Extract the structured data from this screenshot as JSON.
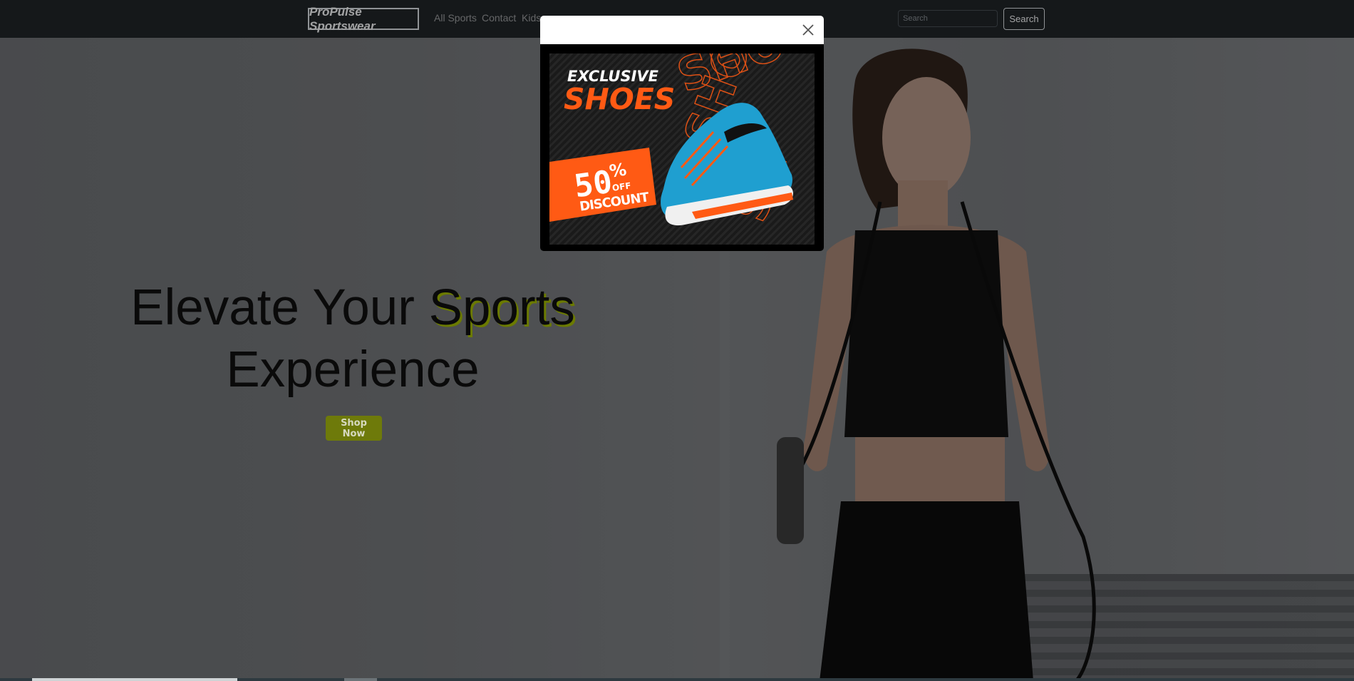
{
  "navbar": {
    "brand": "ProPulse Sportswear",
    "links": [
      "All Sports",
      "Contact",
      "Kids"
    ],
    "search_placeholder": "Search",
    "search_button": "Search"
  },
  "hero": {
    "title_part1": "Elevate Your ",
    "title_accent": "Sports",
    "title_part2": "Experience",
    "cta": "Shop Now"
  },
  "modal": {
    "close_icon": "close-icon",
    "promo": {
      "line1": "EXCLUSIVE",
      "line2": "SHOES",
      "discount_number": "50",
      "discount_percent": "%",
      "discount_off": "OFF",
      "discount_label": "DISCOUNT"
    }
  },
  "colors": {
    "navbar_bg": "#212529",
    "accent_olive": "#6e7a0a",
    "promo_orange": "#ff5a14",
    "shoe_blue": "#1f9fd0"
  }
}
